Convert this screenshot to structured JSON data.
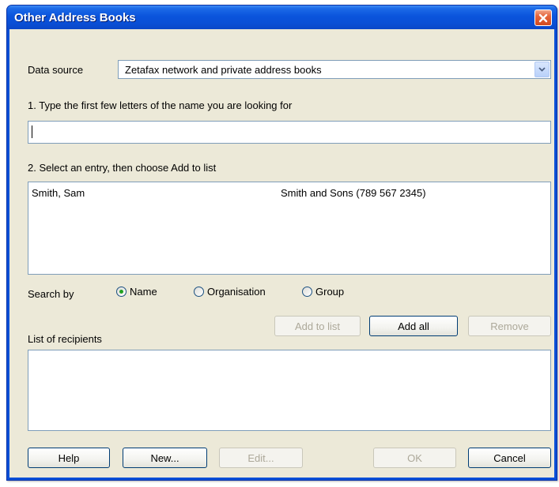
{
  "window": {
    "title": "Other Address Books"
  },
  "data_source": {
    "label": "Data source",
    "value": "Zetafax network and private address books"
  },
  "step1": {
    "label": "1. Type the first few letters of the name you are looking for",
    "input_value": ""
  },
  "step2": {
    "label": "2. Select an entry, then choose Add to list",
    "entries": [
      {
        "name": "Smith, Sam",
        "organisation": "Smith and Sons (789 567 2345)"
      }
    ]
  },
  "search_by": {
    "label": "Search by",
    "options": [
      {
        "label": "Name",
        "selected": true
      },
      {
        "label": "Organisation",
        "selected": false
      },
      {
        "label": "Group",
        "selected": false
      }
    ]
  },
  "list_buttons": {
    "add_to_list": "Add to list",
    "add_all": "Add all",
    "remove": "Remove"
  },
  "recipients": {
    "label": "List of recipients"
  },
  "footer_buttons": {
    "help": "Help",
    "new": "New...",
    "edit": "Edit...",
    "ok": "OK",
    "cancel": "Cancel"
  },
  "colors": {
    "titlebar": "#0a4fd6",
    "dialog_bg": "#ece9d8",
    "close_button": "#e5643a",
    "radio_dot": "#21a121"
  }
}
